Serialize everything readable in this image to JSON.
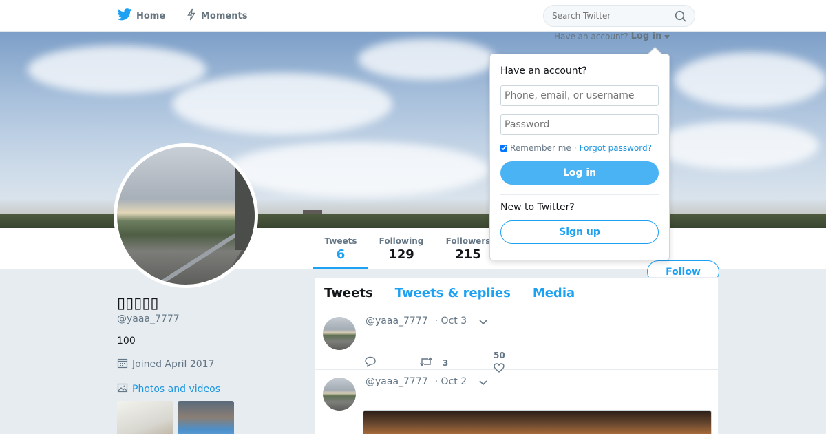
{
  "nav": {
    "home_label": "Home",
    "moments_label": "Moments",
    "search_placeholder": "Search Twitter"
  },
  "profile": {
    "display_name": "▯▯▯▯▯",
    "handle": "@yaaa_7777",
    "bio": "100",
    "joined": "Joined April 2017",
    "photos_label": "Photos and videos"
  },
  "stats": [
    {
      "label": "Tweets",
      "value": "6"
    },
    {
      "label": "Following",
      "value": "129"
    },
    {
      "label": "Followers",
      "value": "215"
    }
  ],
  "follow_label": "Follow",
  "timeline": {
    "tabs": [
      "Tweets",
      "Tweets & replies",
      "Media"
    ],
    "tweets": [
      {
        "handle": "@yaaa_7777",
        "date": "· Oct 3",
        "retweets": "3",
        "likes": "50"
      },
      {
        "handle": "@yaaa_7777",
        "date": "· Oct 2"
      }
    ]
  },
  "login_hint": {
    "prefix": "Have an account?",
    "link": "Log in"
  },
  "login_dropdown": {
    "title": "Have an account?",
    "username_placeholder": "Phone, email, or username",
    "password_placeholder": "Password",
    "remember": "Remember me",
    "separator": "·",
    "forgot": "Forgot password?",
    "login_button": "Log in",
    "new_prompt": "New to Twitter?",
    "signup_button": "Sign up"
  },
  "colors": {
    "accent": "#1da1f2",
    "login_button": "#4ab3f4",
    "background": "#e6ecf0"
  }
}
